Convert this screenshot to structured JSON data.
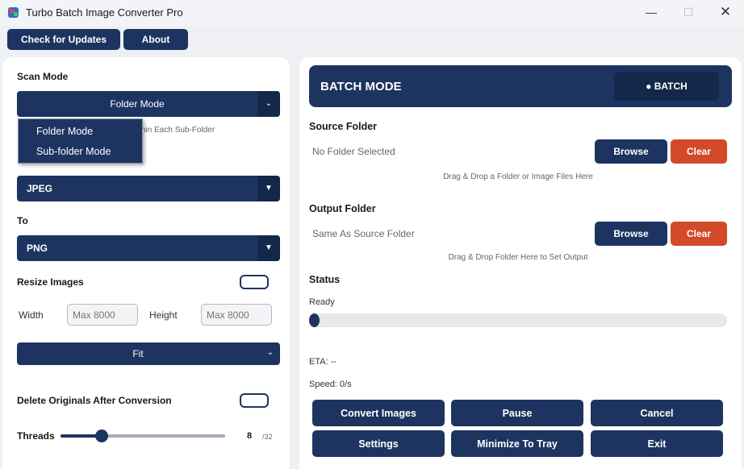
{
  "window": {
    "title": "Turbo Batch Image Converter Pro",
    "minimize": "—",
    "maximize": "☐",
    "close": "✕"
  },
  "toolbar": {
    "check_updates": "Check for Updates",
    "about": "About"
  },
  "left": {
    "scan_mode_label": "Scan Mode",
    "scan_mode_value": "Folder Mode",
    "scan_mode_options": [
      "Folder Mode",
      "Sub-folder Mode"
    ],
    "scan_hint_partial": "hin Each Sub-Folder",
    "from_format": "JPEG",
    "to_label": "To",
    "to_format": "PNG",
    "resize_label": "Resize Images",
    "resize_enabled": false,
    "width_label": "Width",
    "width_placeholder": "Max 8000",
    "height_label": "Height",
    "height_placeholder": "Max 8000",
    "fit_mode": "Fit",
    "delete_label": "Delete Originals After Conversion",
    "delete_enabled": false,
    "threads_label": "Threads",
    "threads_value": "8",
    "threads_max": "/32",
    "threads_fraction": 0.25
  },
  "right": {
    "header_title": "BATCH MODE",
    "header_badge": "● BATCH",
    "source_label": "Source Folder",
    "source_value": "No Folder Selected",
    "source_hint": "Drag & Drop a Folder or Image Files Here",
    "output_label": "Output Folder",
    "output_value": "Same As Source Folder",
    "output_hint": "Drag & Drop Folder Here to Set Output",
    "browse": "Browse",
    "clear": "Clear",
    "status_label": "Status",
    "status_value": "Ready",
    "progress": 0,
    "eta": "ETA: --",
    "speed": "Speed: 0/s",
    "buttons": [
      "Convert Images",
      "Pause",
      "Cancel",
      "Settings",
      "Minimize To Tray",
      "Exit"
    ]
  },
  "colors": {
    "primary": "#1d3461",
    "danger": "#d24a2a",
    "background": "#eef0f3"
  }
}
